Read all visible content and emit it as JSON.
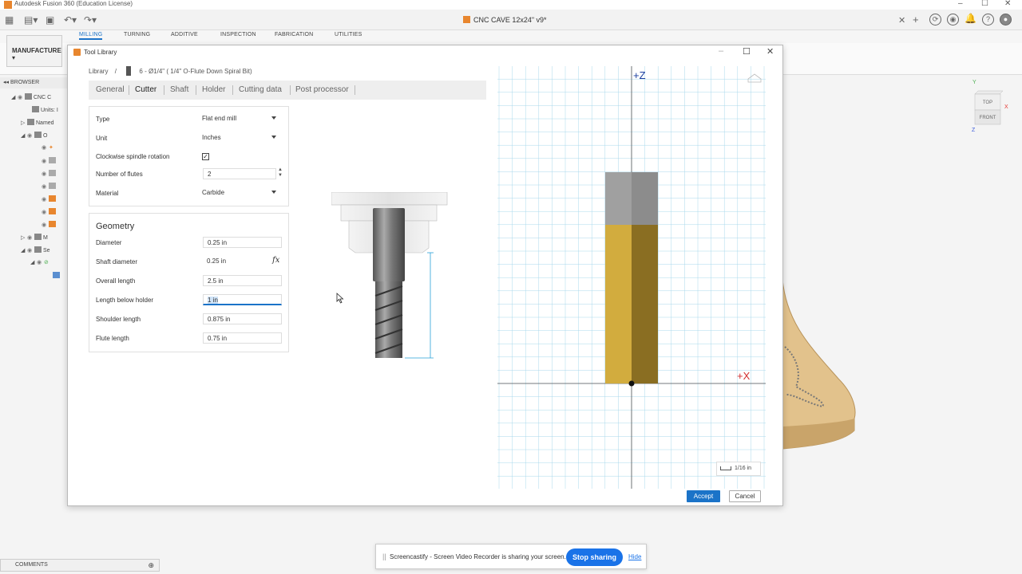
{
  "app": {
    "title": "Autodesk Fusion 360 (Education License)",
    "document_tab": "CNC CAVE 12x24\" v9*"
  },
  "workspace_tabs": [
    "MILLING",
    "TURNING",
    "ADDITIVE",
    "INSPECTION",
    "FABRICATION",
    "UTILITIES"
  ],
  "manufacture_label": "MANUFACTURE",
  "browser": {
    "header": "BROWSER",
    "root": "CNC C",
    "units_label": "Units: I",
    "named_label": "Named",
    "origin_label": "O",
    "models_label": "M",
    "setups_label": "Se"
  },
  "viewcube": {
    "top": "TOP",
    "front": "FRONT",
    "y": "Y",
    "x": "X",
    "z": "Z"
  },
  "dialog": {
    "title": "Tool Library",
    "breadcrumb_root": "Library",
    "breadcrumb_sep": "/",
    "breadcrumb_tool": "6 - Ø1/4\" ( 1/4\" O-Flute Down Spiral Bit)",
    "tabs": [
      "General",
      "Cutter",
      "Shaft",
      "Holder",
      "Cutting data",
      "Post processor"
    ],
    "active_tab": "Cutter",
    "cutter": {
      "type_label": "Type",
      "type_value": "Flat end mill",
      "unit_label": "Unit",
      "unit_value": "Inches",
      "clockwise_label": "Clockwise spindle rotation",
      "clockwise_checked": true,
      "check_mark": "✓",
      "flutes_label": "Number of flutes",
      "flutes_value": "2",
      "material_label": "Material",
      "material_value": "Carbide"
    },
    "geometry": {
      "title": "Geometry",
      "diameter_label": "Diameter",
      "diameter_value": "0.25 in",
      "shaft_diameter_label": "Shaft diameter",
      "shaft_diameter_value": "0.25 in",
      "fx": "fx",
      "overall_length_label": "Overall length",
      "overall_length_value": "2.5 in",
      "length_below_holder_label": "Length below holder",
      "length_below_holder_value": "1 in",
      "shoulder_length_label": "Shoulder length",
      "shoulder_length_value": "0.875 in",
      "flute_length_label": "Flute length",
      "flute_length_value": "0.75 in"
    },
    "grid": {
      "z_axis": "+Z",
      "x_axis": "+X",
      "scale": "1/16 in"
    },
    "accept": "Accept",
    "cancel": "Cancel"
  },
  "share_bar": {
    "grip": "||",
    "message": "Screencastify - Screen Video Recorder is sharing your screen.",
    "stop": "Stop sharing",
    "hide": "Hide"
  },
  "comments": "COMMENTS",
  "colors": {
    "accent": "#1b73c8",
    "flute_gold": "#c9a23a",
    "shank_gray": "#8a8a8a",
    "grid_line": "#9fd3e8"
  }
}
